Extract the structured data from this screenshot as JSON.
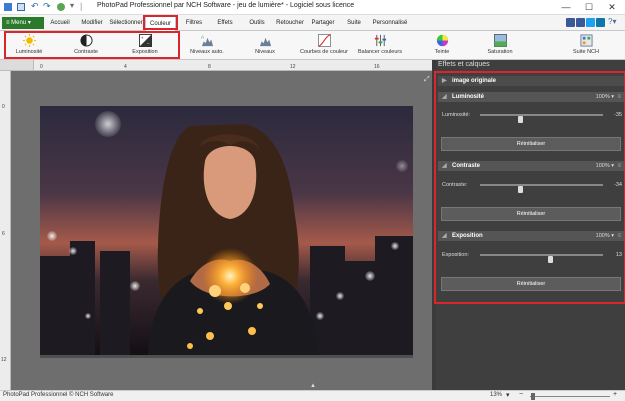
{
  "app": {
    "title": "PhotoPad Professionnel par NCH Software - jeu de lumière* - Logiciel sous licence"
  },
  "menu": {
    "main_button": "≡ Menu ▾",
    "items": [
      "Accueil",
      "Modifier",
      "Sélectionner",
      "Couleur",
      "Filtres",
      "Effets",
      "Outils",
      "Retoucher",
      "Partager",
      "Suite",
      "Personnalisé"
    ],
    "active": "Couleur"
  },
  "toolbar": {
    "items": [
      "Luminosité",
      "Contraste",
      "Exposition",
      "Niveaux auto.",
      "Niveaux",
      "Courbes de couleur",
      "Balancer couleurs",
      "Teinte",
      "Saturation",
      "Suite NCH"
    ]
  },
  "rulers": {
    "h": [
      "0",
      "4",
      "8",
      "12",
      "16"
    ],
    "v": [
      "0",
      "6",
      "12"
    ]
  },
  "panel": {
    "title": "Effets et calques",
    "original": "image originale",
    "sections": [
      {
        "name": "Luminosité",
        "pct": "100% ▾",
        "param": "Luminosité:",
        "value": "-35",
        "fraction": 0.33,
        "reset": "Réinitialiser"
      },
      {
        "name": "Contraste",
        "pct": "100% ▾",
        "param": "Contraste:",
        "value": "-34",
        "fraction": 0.33,
        "reset": "Réinitialiser"
      },
      {
        "name": "Exposition",
        "pct": "100% ▾",
        "param": "Exposition:",
        "value": "13",
        "fraction": 0.57,
        "reset": "Réinitialiser"
      }
    ]
  },
  "status": {
    "left": "PhotoPad Professionnel © NCH Software",
    "zoom": "13%"
  }
}
